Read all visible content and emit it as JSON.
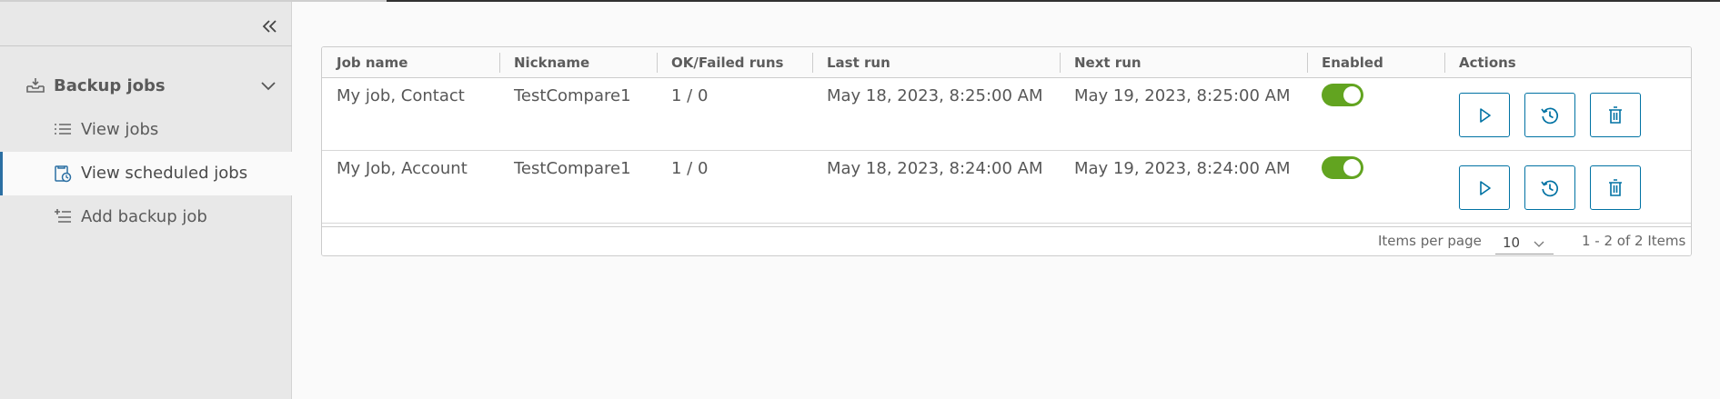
{
  "sidebar": {
    "collapse_icon": "double-chevron-left-icon",
    "group": {
      "label": "Backup jobs",
      "icon": "inbox-tray-icon",
      "expanded": true
    },
    "items": [
      {
        "label": "View jobs",
        "icon": "list-icon",
        "active": false
      },
      {
        "label": "View scheduled jobs",
        "icon": "scheduled-clipboard-icon",
        "active": true
      },
      {
        "label": "Add backup job",
        "icon": "add-list-icon",
        "active": false
      }
    ]
  },
  "table": {
    "columns": [
      "Job name",
      "Nickname",
      "OK/Failed runs",
      "Last run",
      "Next run",
      "Enabled",
      "Actions"
    ],
    "rows": [
      {
        "job_name": "My job, Contact",
        "nickname": "TestCompare1",
        "runs": "1 / 0",
        "last_run": "May 18, 2023, 8:25:00 AM",
        "next_run": "May 19, 2023, 8:25:00 AM",
        "enabled": true
      },
      {
        "job_name": "My Job, Account",
        "nickname": "TestCompare1",
        "runs": "1 / 0",
        "last_run": "May 18, 2023, 8:24:00 AM",
        "next_run": "May 19, 2023, 8:24:00 AM",
        "enabled": true
      }
    ],
    "actions": [
      {
        "name": "run-button",
        "icon": "play-icon"
      },
      {
        "name": "history-button",
        "icon": "history-icon"
      },
      {
        "name": "delete-button",
        "icon": "trash-icon"
      }
    ]
  },
  "pagination": {
    "items_per_page_label": "Items per page",
    "items_per_page_value": "10",
    "range_text": "1 - 2 of 2 Items"
  },
  "colors": {
    "accent": "#0072a3",
    "toggle_on": "#62a420",
    "active_marker": "#2b6fa3"
  }
}
